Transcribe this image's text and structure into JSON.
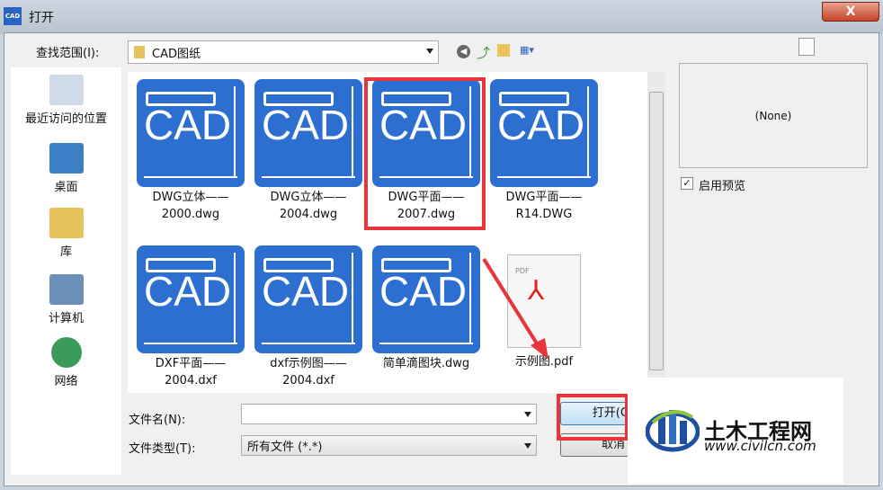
{
  "window": {
    "title": "打开",
    "app_icon_text": "CAD",
    "close_label": "X"
  },
  "lookin": {
    "label": "查找范围(I):",
    "value": "CAD图纸"
  },
  "places": [
    {
      "label": "最近访问的位置",
      "icon": "recent-places-icon"
    },
    {
      "label": "桌面",
      "icon": "desktop-icon"
    },
    {
      "label": "库",
      "icon": "libraries-icon"
    },
    {
      "label": "计算机",
      "icon": "computer-icon"
    },
    {
      "label": "网络",
      "icon": "network-icon"
    }
  ],
  "files": [
    {
      "name1": "DWG立体——",
      "name2": "2000.dwg",
      "type": "cad"
    },
    {
      "name1": "DWG立体——",
      "name2": "2004.dwg",
      "type": "cad"
    },
    {
      "name1": "DWG平面——",
      "name2": "2007.dwg",
      "type": "cad"
    },
    {
      "name1": "DWG平面——",
      "name2": "R14.DWG",
      "type": "cad"
    },
    {
      "name1": "DXF平面——",
      "name2": "2004.dxf",
      "type": "cad"
    },
    {
      "name1": "dxf示例图——",
      "name2": "2004.dxf",
      "type": "cad"
    },
    {
      "name1": "简单滴图块.dwg",
      "name2": "",
      "type": "cad"
    },
    {
      "name1": "示例图.pdf",
      "name2": "",
      "type": "pdf"
    }
  ],
  "tile_text": "CAD",
  "pdf_badge": "PDF",
  "preview": {
    "text": "(None)",
    "checkbox_label": "启用预览",
    "checked": true
  },
  "filename": {
    "label": "文件名(N):",
    "value": ""
  },
  "filetype": {
    "label": "文件类型(T):",
    "value": "所有文件 (*.*)"
  },
  "buttons": {
    "open": "打开(O)",
    "cancel": "取消"
  },
  "watermark": {
    "name": "土木工程网",
    "url": "www.civilcn.com"
  },
  "colors": {
    "tile": "#2d6fd1",
    "highlight": "#e8343a"
  }
}
